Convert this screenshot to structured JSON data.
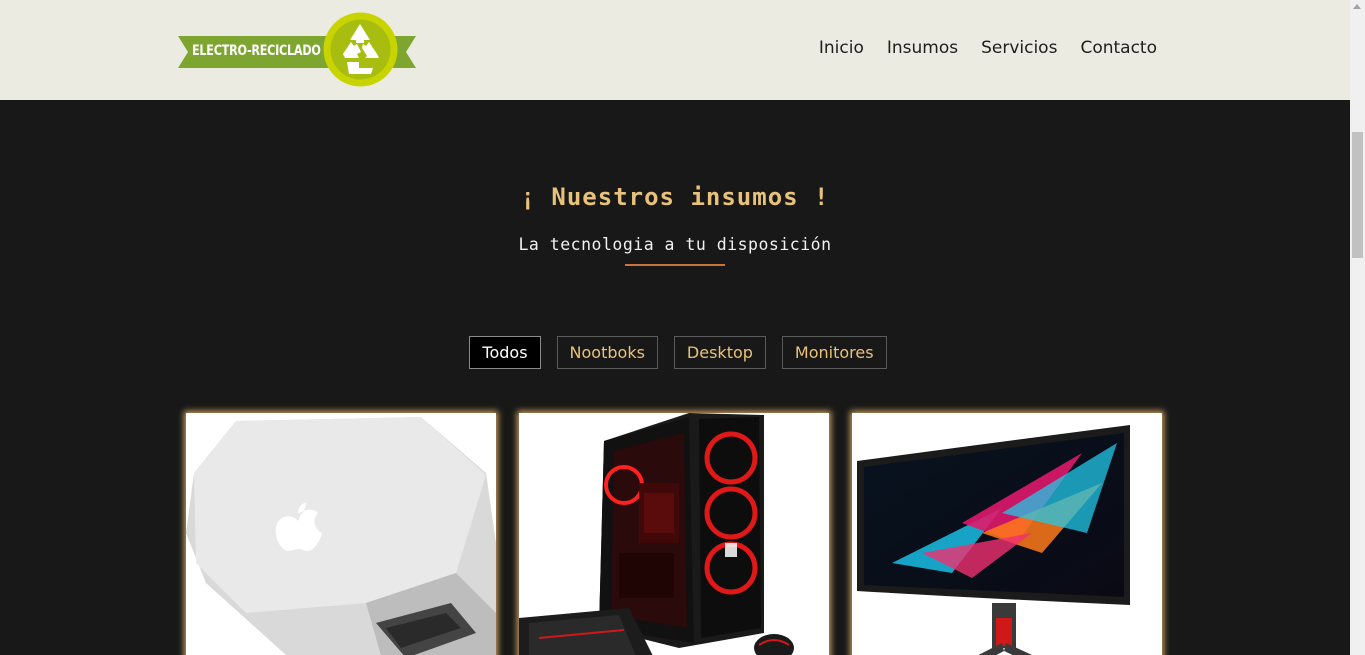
{
  "header": {
    "logo_text": "ELECTRO-RECICLADO",
    "nav": [
      "Inicio",
      "Insumos",
      "Servicios",
      "Contacto"
    ]
  },
  "section": {
    "title": "¡ Nuestros insumos !",
    "subtitle": "La tecnologia a tu disposición"
  },
  "filters": [
    "Todos",
    "Nootboks",
    "Desktop",
    "Monitores"
  ],
  "active_filter": "Todos",
  "products": [
    {
      "image": "laptop-image"
    },
    {
      "image": "desktop-pc-image"
    },
    {
      "image": "monitor-image"
    }
  ],
  "colors": {
    "header_bg": "#ecebe1",
    "page_bg": "#181818",
    "accent_gold": "#e8c27a",
    "divider": "#c8743a",
    "logo_green": "#7ea530",
    "logo_lime": "#c8d400"
  }
}
